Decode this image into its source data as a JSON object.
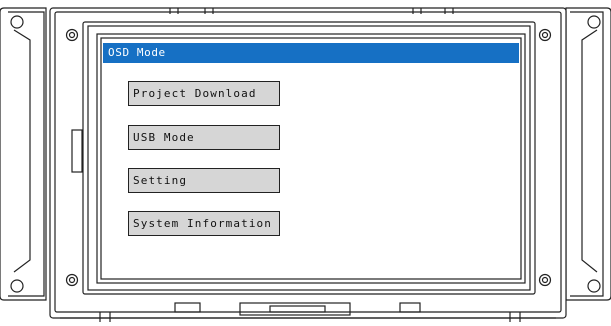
{
  "window": {
    "title": "OSD Mode"
  },
  "menu": {
    "items": [
      {
        "label": "Project Download"
      },
      {
        "label": "USB Mode"
      },
      {
        "label": "Setting"
      },
      {
        "label": "System Information"
      }
    ]
  },
  "colors": {
    "title_bar": "#1670c4",
    "button_bg": "#d6d6d6",
    "outline": "#222222"
  }
}
